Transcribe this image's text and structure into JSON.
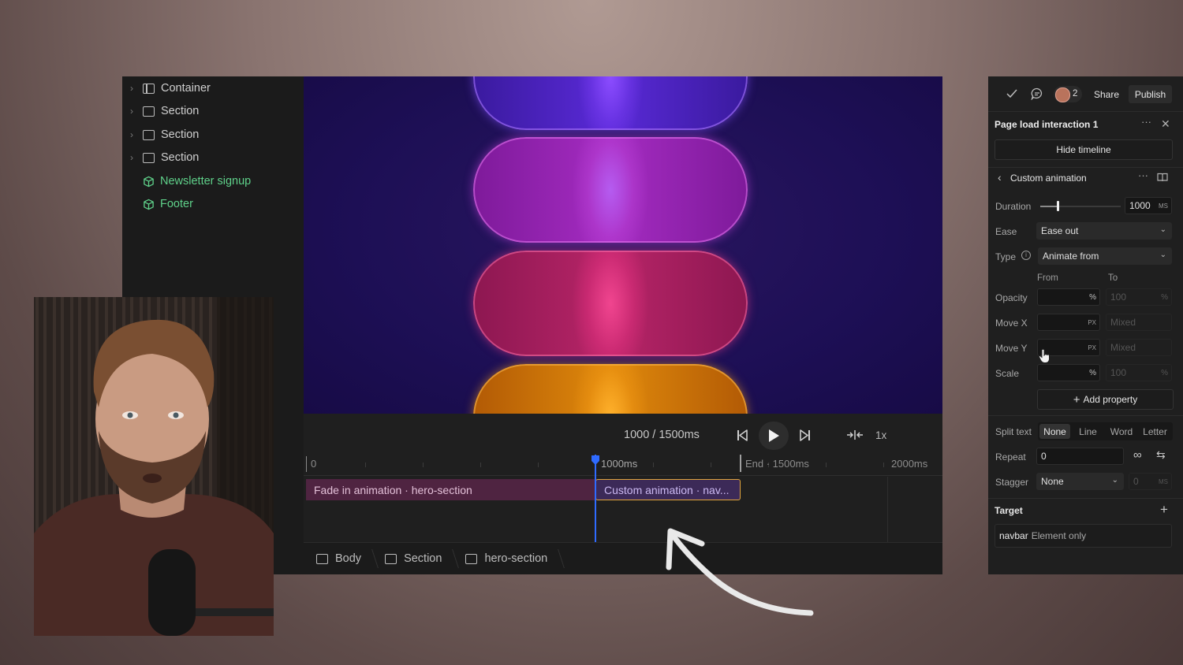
{
  "navigator": {
    "items": [
      {
        "label": "Container",
        "kind": "container"
      },
      {
        "label": "Section",
        "kind": "section"
      },
      {
        "label": "Section",
        "kind": "section"
      },
      {
        "label": "Section",
        "kind": "section"
      },
      {
        "label": "Newsletter signup",
        "kind": "component"
      },
      {
        "label": "Footer",
        "kind": "component"
      }
    ]
  },
  "canvas": {
    "pill_colors": [
      "#7a3cf0",
      "#c23ad8",
      "#e8338f",
      "#f39313"
    ]
  },
  "timeline": {
    "time_display": "1000 / 1500ms",
    "speed": "1x",
    "ruler": {
      "start": "0",
      "playhead": "1000ms",
      "end": "End · 1500ms",
      "max": "2000ms"
    },
    "tracks": [
      {
        "label": "Fade in animation · hero-section"
      },
      {
        "label": "Custom animation · nav..."
      }
    ]
  },
  "breadcrumbs": [
    "Body",
    "Section",
    "hero-section"
  ],
  "panel": {
    "toolbar": {
      "collaborators_count": "2",
      "share_label": "Share",
      "publish_label": "Publish"
    },
    "interaction_title": "Page load interaction 1",
    "hide_timeline_label": "Hide timeline",
    "animation_title": "Custom animation",
    "duration": {
      "label": "Duration",
      "value": "1000",
      "unit": "MS",
      "slider_fraction": 0.22
    },
    "ease": {
      "label": "Ease",
      "value": "Ease out"
    },
    "type": {
      "label": "Type",
      "value": "Animate from"
    },
    "columns": {
      "from": "From",
      "to": "To"
    },
    "properties": [
      {
        "label": "Opacity",
        "from_unit": "%",
        "to_value": "100",
        "to_unit": "%"
      },
      {
        "label": "Move X",
        "from_unit": "PX",
        "to_value": "Mixed",
        "to_unit": ""
      },
      {
        "label": "Move Y",
        "from_unit": "PX",
        "to_value": "Mixed",
        "to_unit": ""
      },
      {
        "label": "Scale",
        "from_unit": "%",
        "to_value": "100",
        "to_unit": "%"
      }
    ],
    "add_property_label": "Add property",
    "split_text": {
      "label": "Split text",
      "options": [
        "None",
        "Line",
        "Word",
        "Letter"
      ],
      "selected": "None"
    },
    "repeat": {
      "label": "Repeat",
      "value": "0"
    },
    "stagger": {
      "label": "Stagger",
      "value": "None",
      "amount": "0",
      "unit": "MS"
    },
    "target": {
      "label": "Target",
      "element": "navbar",
      "scope": "Element only"
    }
  },
  "colors": {
    "accent_blue": "#2f6bff",
    "track_pink": "#5a2747",
    "track_selected_border": "#e0a43c",
    "component_green": "#5fd18a"
  }
}
